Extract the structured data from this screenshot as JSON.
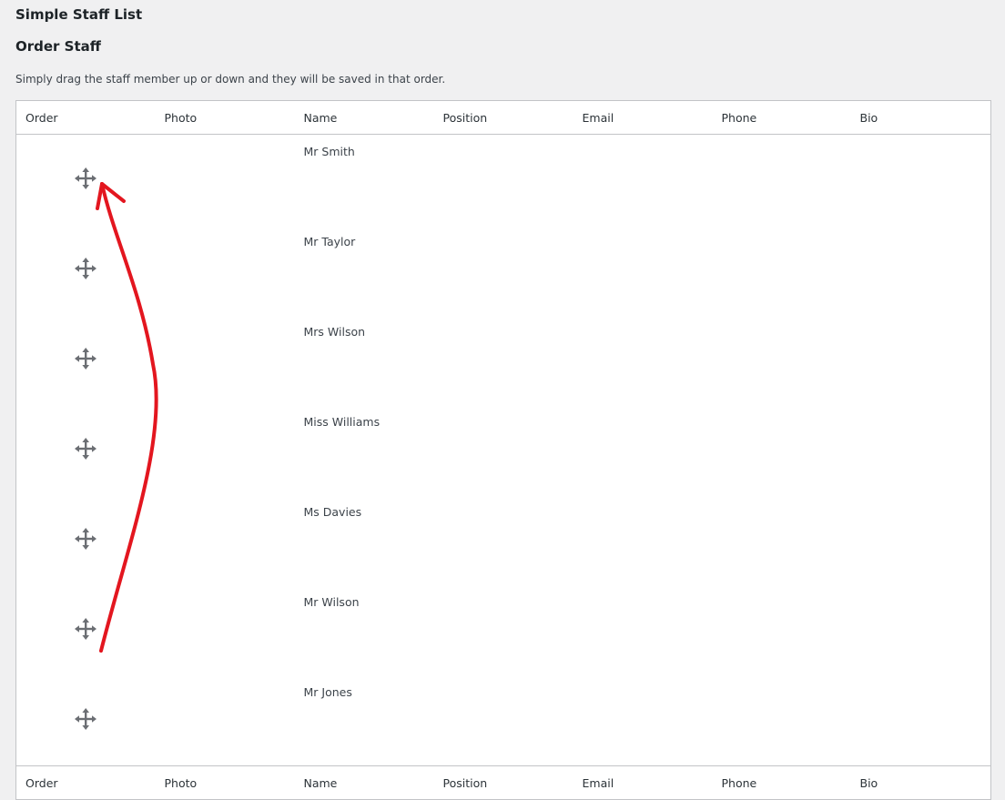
{
  "page": {
    "title": "Simple Staff List",
    "subtitle": "Order Staff",
    "description": "Simply drag the staff member up or down and they will be saved in that order."
  },
  "table": {
    "columns": [
      "Order",
      "Photo",
      "Name",
      "Position",
      "Email",
      "Phone",
      "Bio"
    ],
    "rows": [
      {
        "name": "Mr Smith"
      },
      {
        "name": "Mr Taylor"
      },
      {
        "name": "Mrs Wilson"
      },
      {
        "name": "Miss Williams"
      },
      {
        "name": "Ms Davies"
      },
      {
        "name": "Mr Wilson"
      },
      {
        "name": "Mr Jones"
      }
    ]
  },
  "icons": {
    "drag_handle": "move-icon",
    "annotation": "red-arrow"
  },
  "colors": {
    "annotation": "#e3161f",
    "icon": "#6b6e73"
  }
}
